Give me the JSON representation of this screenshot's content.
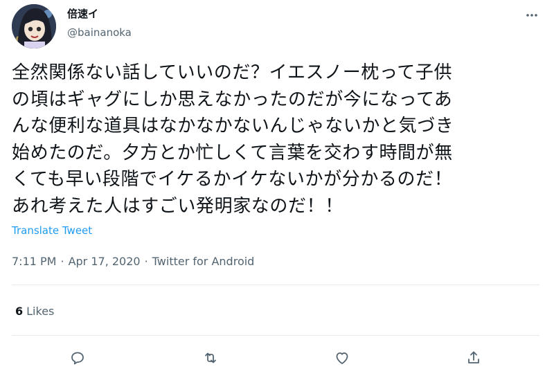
{
  "author": {
    "display_name": "倍速イ",
    "handle": "@bainanoka"
  },
  "tweet": {
    "text": "全然関係ない話していいのだ？イエスノー枕って子供\nの頃はギャグにしか思えなかったのだが今になってあ\nんな便利な道具はなかなかないんじゃないかと気づき\n始めたのだ。夕方とか忙しくて言葉を交わす時間が無\nくても早い段階でイケるかイケないかが分かるのだ！\nあれ考えた人はすごい発明家なのだ！！",
    "translate_label": "Translate Tweet",
    "time": "7:11 PM",
    "separator": "·",
    "date": "Apr 17, 2020",
    "source": "Twitter for Android"
  },
  "stats": {
    "likes_count": "6",
    "likes_label": "Likes"
  },
  "actions": [
    {
      "icon": "reply-icon"
    },
    {
      "icon": "retweet-icon"
    },
    {
      "icon": "like-icon"
    },
    {
      "icon": "share-icon"
    }
  ],
  "colors": {
    "text": "#0f1419",
    "secondary": "#536471",
    "link": "#1d9bf0",
    "divider": "#e7eaed"
  }
}
